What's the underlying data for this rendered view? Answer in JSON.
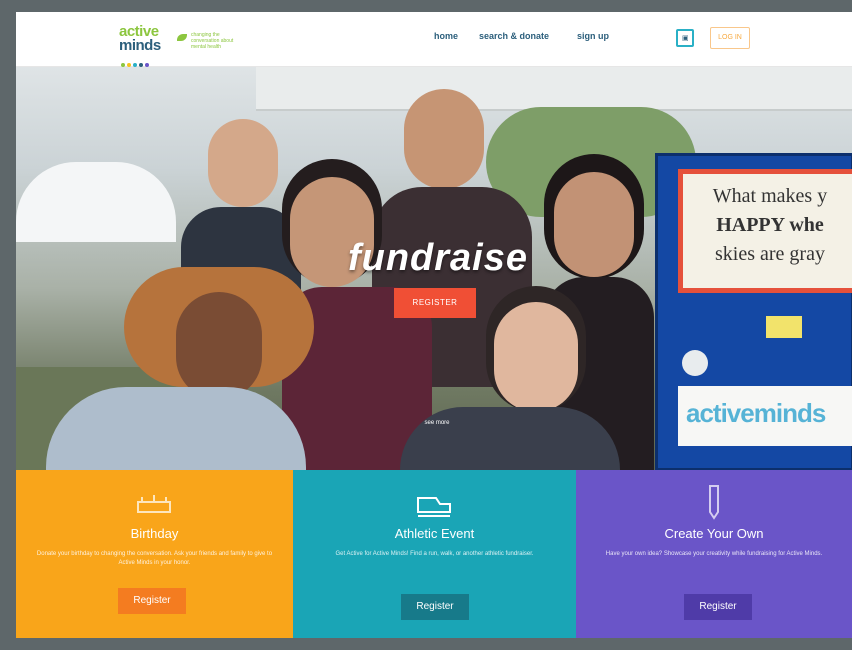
{
  "header": {
    "logo_line1": "active",
    "logo_line2": "minds",
    "logo_sub": "changing the conversation about mental health",
    "nav": [
      "home",
      "search & donate",
      "sign up"
    ],
    "cart_icon": "cart-icon",
    "login_label": "LOG IN"
  },
  "hero": {
    "title": "fundraise",
    "register_label": "REGISTER",
    "see_more": "see more",
    "sign_text": [
      "What makes y",
      "HAPPY whe",
      "skies are gray"
    ],
    "board_logo_text": "activeminds"
  },
  "cards": [
    {
      "icon": "cake-icon",
      "title": "Birthday",
      "description": "Donate your birthday to changing the conversation. Ask your friends and family to give to Active Minds in your honor.",
      "button": "Register",
      "color": "#f9a51a",
      "button_color": "#f47c20"
    },
    {
      "icon": "shoe-icon",
      "title": "Athletic Event",
      "description": "Get Active for Active Minds! Find a run, walk, or another athletic fundraiser.",
      "button": "Register",
      "color": "#1aa5b6",
      "button_color": "#177a8a"
    },
    {
      "icon": "pencil-icon",
      "title": "Create Your Own",
      "description": "Have your own idea? Showcase your creativity while fundraising for Active Minds.",
      "button": "Register",
      "color": "#6a55c8",
      "button_color": "#4f3ba8"
    }
  ],
  "colors": {
    "accent_orange": "#f04f35",
    "brand_green": "#8cc63f",
    "brand_blue": "#2c5f7c"
  }
}
